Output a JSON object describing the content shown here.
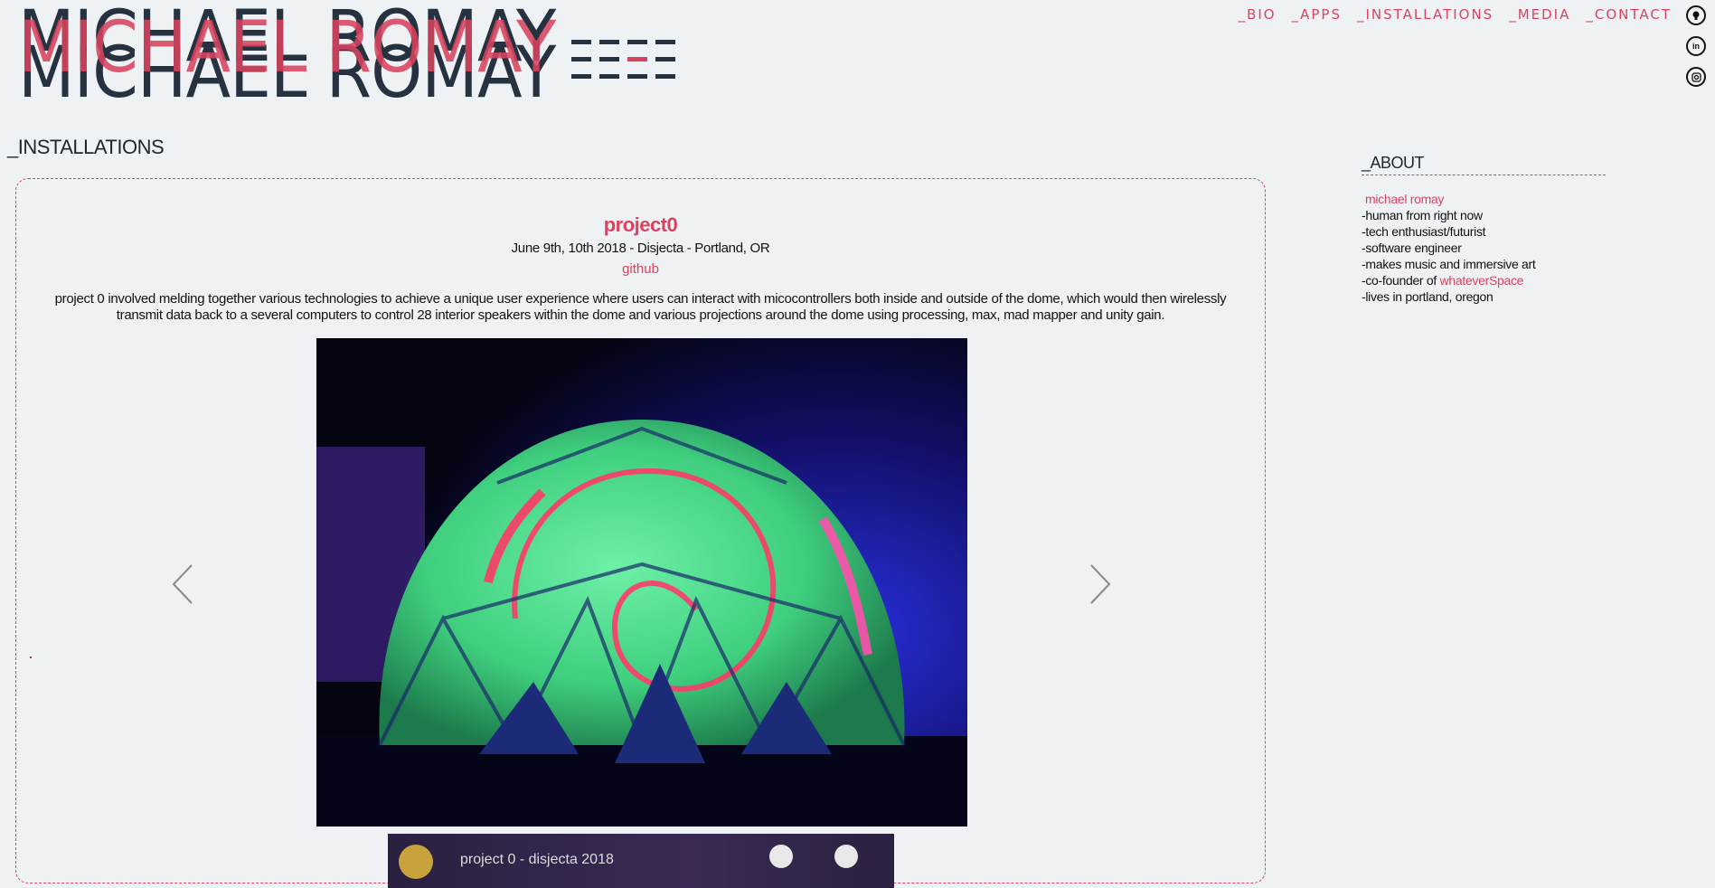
{
  "logo": {
    "name": "MICHAEL ROMAY"
  },
  "nav": {
    "items": [
      "_BIO",
      "_APPS",
      "_INSTALLATIONS",
      "_MEDIA",
      "_CONTACT"
    ]
  },
  "social": {
    "icons": [
      "github-icon",
      "linkedin-icon",
      "instagram-icon"
    ]
  },
  "section": {
    "heading": "_INSTALLATIONS"
  },
  "project": {
    "title": "project0",
    "date_location": "June 9th, 10th 2018 - Disjecta - Portland, OR",
    "link": "github",
    "description": "project 0 involved melding together various technologies to achieve a unique user experience where users can interact with micocontrollers both inside and outside of the dome, which would then wirelessly transmit data back to a several computers to control 28 interior speakers within the dome and various projections around the dome using processing, max, mad mapper and unity gain.",
    "image_subject": "geodesic dome with green and red spiral projection",
    "video_title": "project 0 - disjecta 2018"
  },
  "about": {
    "heading": "_ABOUT",
    "name": "michael romay",
    "lines": [
      "-human from right now",
      "-tech enthusiast/futurist",
      "-software engineer",
      "-makes music and immersive art"
    ],
    "cofounder_prefix": "-co-founder of ",
    "cofounder_link": "whateverSpace",
    "last_line": "-lives in portland, oregon"
  },
  "colors": {
    "accent": "#d9435f",
    "dark": "#263240",
    "background": "#eff2f5"
  }
}
